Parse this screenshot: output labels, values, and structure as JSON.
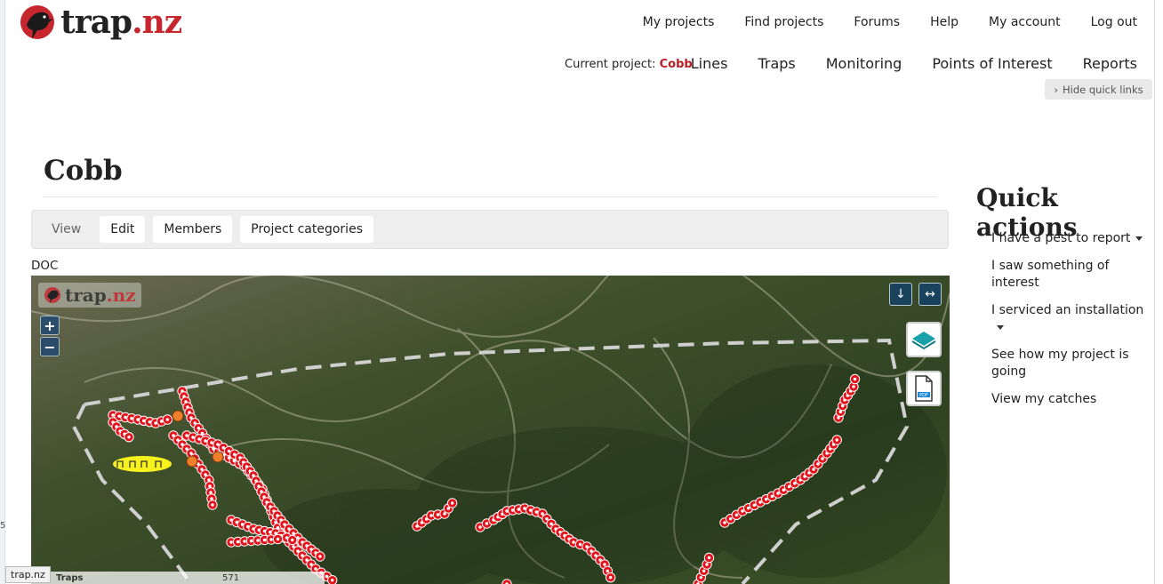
{
  "brand": {
    "name_main": "trap",
    "name_accent": ".nz"
  },
  "topnav": [
    "My projects",
    "Find projects",
    "Forums",
    "Help",
    "My account",
    "Log out"
  ],
  "current_project": {
    "label": "Current project:",
    "name": "Cobb"
  },
  "secnav": [
    "Lines",
    "Traps",
    "Monitoring",
    "Points of Interest",
    "Reports"
  ],
  "hide_quick_links": "Hide quick links",
  "page": {
    "title": "Cobb"
  },
  "tabs": [
    {
      "label": "View",
      "active": true
    },
    {
      "label": "Edit",
      "active": false
    },
    {
      "label": "Members",
      "active": false
    },
    {
      "label": "Project categories",
      "active": false
    }
  ],
  "org_label": "DOC",
  "map": {
    "logo_main": "trap",
    "logo_accent": ".nz",
    "zoom_in": "+",
    "zoom_out": "−",
    "footer_label": "Traps",
    "footer_count": "571"
  },
  "quick_actions": {
    "title": "Quick actions",
    "items": [
      {
        "label": "I have a pest to report",
        "dropdown": true
      },
      {
        "label": "I saw something of interest",
        "dropdown": false
      },
      {
        "label": "I serviced an installation",
        "dropdown": true
      },
      {
        "label": "See how my project is going",
        "dropdown": false
      },
      {
        "label": "View my catches",
        "dropdown": false
      }
    ]
  },
  "status_bar": "trap.nz",
  "edge_number": "5",
  "colors": {
    "brand_red": "#c8262e",
    "current_project_red": "#b81e25",
    "trap_marker": "#e3131b",
    "poi_marker": "#f07f2c",
    "highlight": "#f7f11d"
  }
}
